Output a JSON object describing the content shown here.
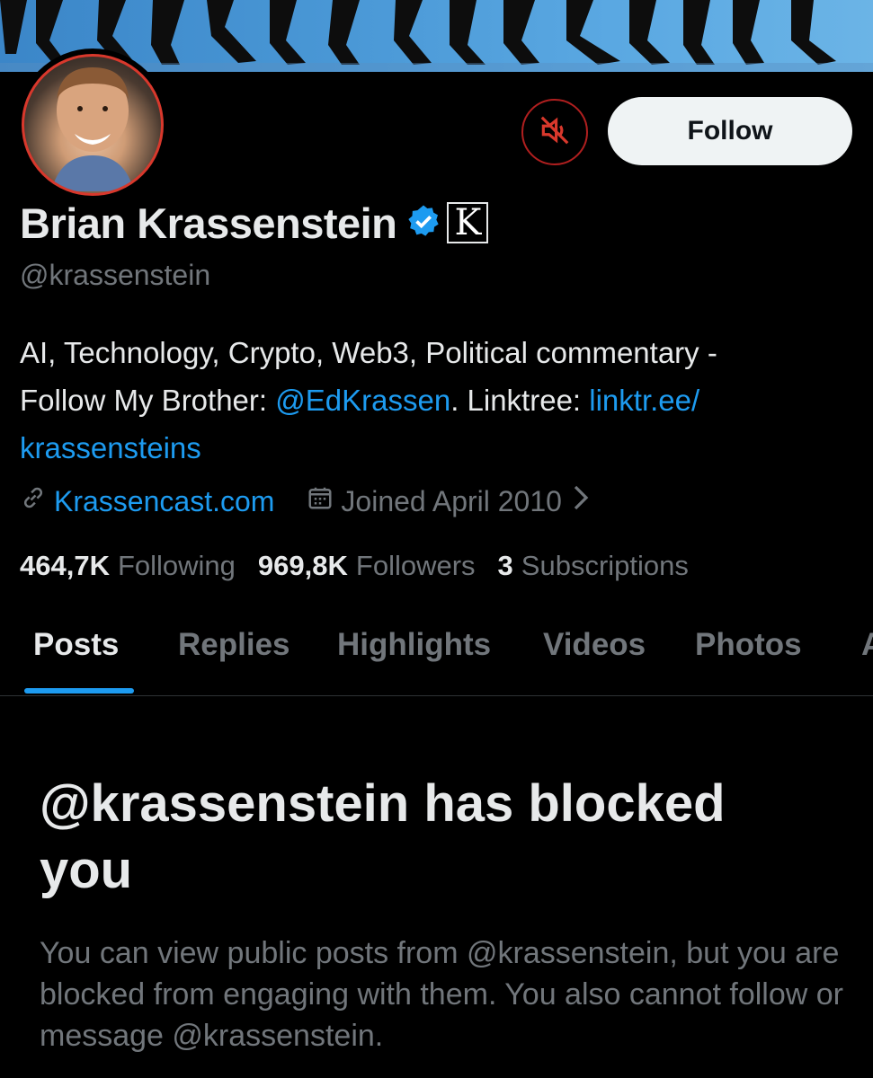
{
  "profile": {
    "name": "Brian Krassenstein",
    "handle": "@krassenstein",
    "badge_letter": "K",
    "follow_label": "Follow",
    "bio": {
      "line_text_1": "AI, Technology, Crypto, Web3, Political commentary -",
      "line_text_2_prefix": "Follow My Brother: ",
      "mention": "@EdKrassen",
      "line_text_2_middle": ". Linktree: ",
      "linktree_part1": "linktr.ee/",
      "linktree_part2": "krassensteins"
    },
    "website": "Krassencast.com",
    "joined": "Joined April 2010",
    "stats": {
      "following_count": "464,7K",
      "following_label": "Following",
      "followers_count": "969,8K",
      "followers_label": "Followers",
      "subscriptions_count": "3",
      "subscriptions_label": "Subscriptions"
    }
  },
  "tabs": [
    {
      "label": "Posts",
      "active": true
    },
    {
      "label": "Replies"
    },
    {
      "label": "Highlights"
    },
    {
      "label": "Videos"
    },
    {
      "label": "Photos"
    },
    {
      "label": "A"
    }
  ],
  "blocked": {
    "title_line1": "@krassenstein has blocked",
    "title_line2": "you",
    "description": "You can view public posts from @krassenstein, but you are blocked from engaging with them. You also cannot follow or message @krassenstein."
  },
  "colors": {
    "accent": "#1d9bf0",
    "muted_text": "#71767b",
    "mute_button_red": "#b01f1f",
    "avatar_ring": "#d8382c"
  },
  "icons": [
    "muted-speaker-icon",
    "verified-badge-icon",
    "link-icon",
    "calendar-icon",
    "chevron-right-icon"
  ]
}
